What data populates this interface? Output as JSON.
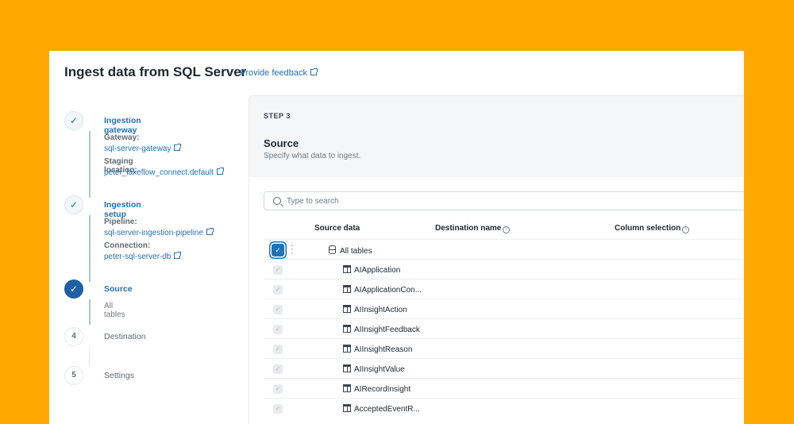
{
  "header": {
    "title": "Ingest data from SQL Server",
    "feedback_link": "Provide feedback"
  },
  "steps": [
    {
      "number": "1",
      "label": "Ingestion gateway",
      "status": "complete",
      "details": [
        {
          "label": "Gateway:",
          "value": "sql-server-gateway"
        },
        {
          "label": "Staging location:",
          "value": "peter_lakeflow_connect.default"
        }
      ]
    },
    {
      "number": "2",
      "label": "Ingestion setup",
      "status": "complete",
      "details": [
        {
          "label": "Pipeline:",
          "value": "sql-server-ingestion-pipeline"
        },
        {
          "label": "Connection:",
          "value": "peter-sql-server-db"
        }
      ]
    },
    {
      "number": "3",
      "label": "Source",
      "status": "current",
      "summary": "All tables"
    },
    {
      "number": "4",
      "label": "Destination",
      "status": "pending"
    },
    {
      "number": "5",
      "label": "Settings",
      "status": "pending"
    }
  ],
  "panel": {
    "step_label": "STEP 3",
    "title": "Source",
    "description": "Specify what data to ingest.",
    "search_placeholder": "Type to search"
  },
  "table": {
    "columns": [
      "Source data",
      "Destination name",
      "Column selection"
    ],
    "root": {
      "name": "All tables",
      "checked": true
    },
    "rows": [
      "AIApplication",
      "AIApplicationCon...",
      "AIInsightAction",
      "AIInsightFeedback",
      "AIInsightReason",
      "AIInsightValue",
      "AIRecordInsight",
      "AcceptedEventR..."
    ]
  },
  "colors": {
    "background": "#FFA800",
    "accent": "#2272b4"
  }
}
